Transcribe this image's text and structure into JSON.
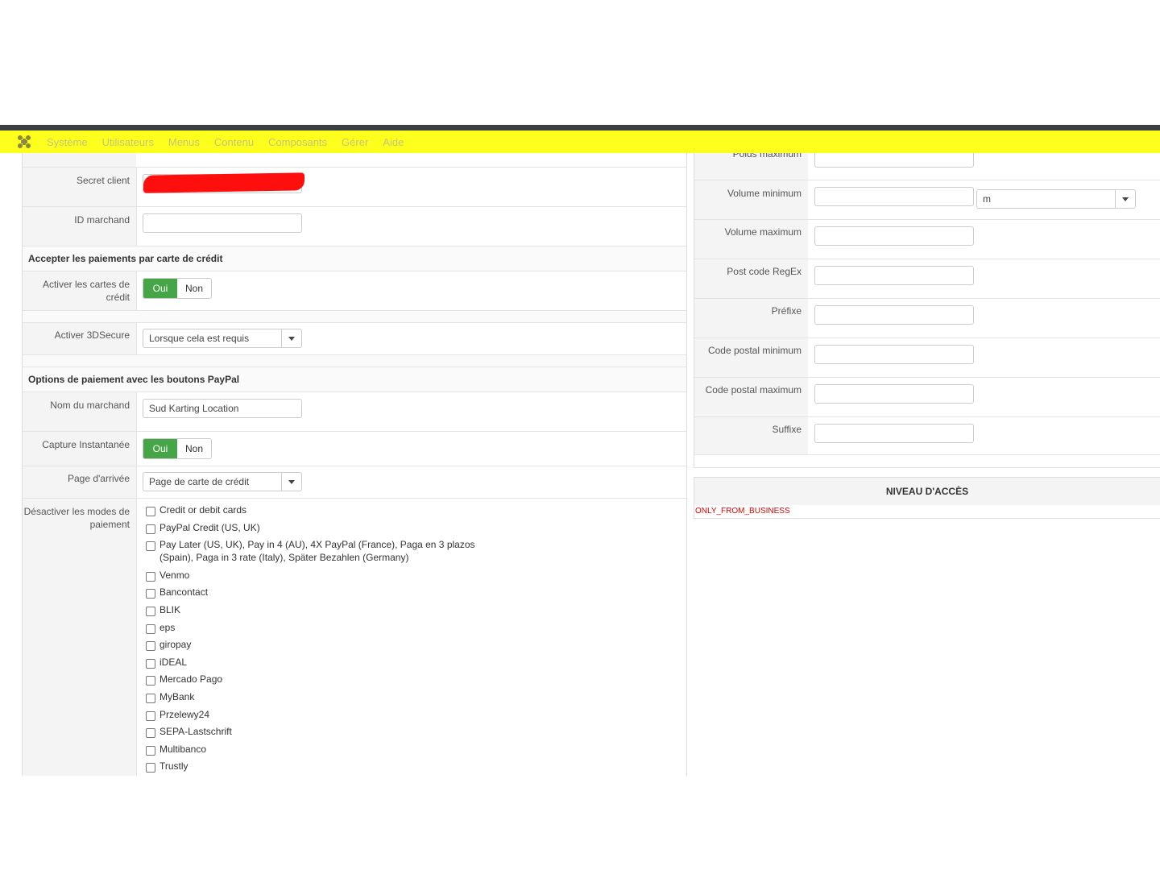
{
  "navbar": {
    "logo_icon": "joomla-icon",
    "items": [
      "Système",
      "Utilisateurs",
      "Menus",
      "Contenu",
      "Composants",
      "Gérer",
      "Aide"
    ]
  },
  "left": {
    "secret_client_label": "Secret client",
    "merchant_id_label": "ID marchand",
    "merchant_id_value": "",
    "credit_section_title": "Accepter les paiements par carte de crédit",
    "enable_cards_label": "Activer les cartes de crédit",
    "toggle_yes": "Oui",
    "toggle_no": "Non",
    "enable_3ds_label": "Activer 3DSecure",
    "enable_3ds_value": "Lorsque cela est requis",
    "paypal_section_title": "Options de paiement avec les boutons PayPal",
    "merchant_name_label": "Nom du marchand",
    "merchant_name_value": "Sud Karting Location",
    "instant_capture_label": "Capture Instantanée",
    "landing_page_label": "Page d'arrivée",
    "landing_page_value": "Page de carte de crédit",
    "disable_methods_label": "Désactiver les modes de paiement",
    "methods": [
      "Credit or debit cards",
      "PayPal Credit (US, UK)",
      "Pay Later (US, UK), Pay in 4 (AU), 4X PayPal (France), Paga en 3 plazos (Spain), Paga in 3 rate (Italy), Später Bezahlen (Germany)",
      "Venmo",
      "Bancontact",
      "BLIK",
      "eps",
      "giropay",
      "iDEAL",
      "Mercado Pago",
      "MyBank",
      "Przelewy24",
      "SEPA-Lastschrift",
      "Multibanco",
      "Trustly"
    ]
  },
  "right": {
    "weight_max_label": "Poids maximum",
    "volume_min_label": "Volume minimum",
    "volume_unit": "m",
    "volume_max_label": "Volume maximum",
    "postcode_regex_label": "Post code RegEx",
    "prefix_label": "Préfixe",
    "postcode_min_label": "Code postal minimum",
    "postcode_max_label": "Code postal maximum",
    "suffix_label": "Suffixe"
  },
  "access": {
    "title": "NIVEAU D'ACCÈS",
    "value": "ONLY_FROM_BUSINESS"
  },
  "colors": {
    "navbar_bg": "#ffff1e",
    "toggle_on": "#46a546",
    "access_value": "#dd0000"
  }
}
